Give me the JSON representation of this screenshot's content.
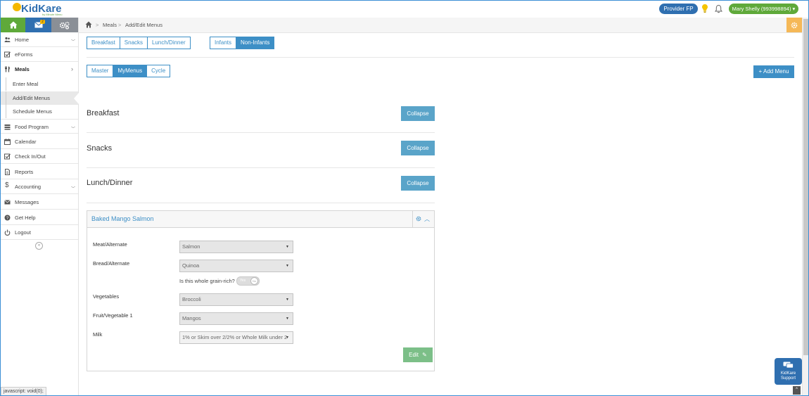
{
  "app": {
    "logo_text": "KidKare",
    "logo_subtext": "by Minute Menu",
    "provider_label": "Provider FP",
    "user_label": "Mary Shelly (993998894) ▾"
  },
  "sidebar": {
    "mail_badge": "2",
    "items": [
      {
        "label": "Home"
      },
      {
        "label": "eForms"
      },
      {
        "label": "Meals"
      },
      {
        "label": "Food Program"
      },
      {
        "label": "Calendar"
      },
      {
        "label": "Check In/Out"
      },
      {
        "label": "Reports"
      },
      {
        "label": "Accounting"
      },
      {
        "label": "Messages"
      },
      {
        "label": "Get Help"
      },
      {
        "label": "Logout"
      }
    ],
    "meals_sub": [
      {
        "label": "Enter Meal"
      },
      {
        "label": "Add/Edit Menus"
      },
      {
        "label": "Schedule Menus"
      }
    ],
    "status_text": "javascript: void(0);"
  },
  "breadcrumb": {
    "items": [
      "Meals",
      "Add/Edit Menus"
    ],
    "sep": ">"
  },
  "main": {
    "meal_tabs": [
      "Breakfast",
      "Snacks",
      "Lunch/Dinner"
    ],
    "age_tabs": [
      "Infants",
      "Non-Infants"
    ],
    "age_tab_selected": "Non-Infants",
    "menu_tabs": [
      "Master",
      "MyMenus",
      "Cycle"
    ],
    "menu_tab_selected": "MyMenus",
    "add_menu_label": "+ Add Menu",
    "sections": [
      {
        "title": "Breakfast",
        "button": "Collapse"
      },
      {
        "title": "Snacks",
        "button": "Collapse"
      },
      {
        "title": "Lunch/Dinner",
        "button": "Collapse"
      }
    ],
    "menu_card": {
      "title": "Baked Mango Salmon",
      "fields": [
        {
          "label": "Meat/Alternate",
          "value": "Salmon"
        },
        {
          "label": "Bread/Alternate",
          "value": "Quinoa"
        },
        {
          "label": "Vegetables",
          "value": "Broccoli"
        },
        {
          "label": "Fruit/Vegetable 1",
          "value": "Mangos"
        },
        {
          "label": "Milk",
          "value": "1% or Skim over 2/2% or Whole Milk under 2"
        }
      ],
      "grain_question": "Is this whole grain-rich?",
      "grain_toggle_on": "Yes",
      "grain_toggle_off": "No",
      "edit_label": "Edit"
    }
  },
  "support": {
    "label_line1": "KidKare",
    "label_line2": "Support"
  },
  "colors": {
    "brand_blue": "#2f6fb0",
    "brand_green": "#5fa93a",
    "accent_blue": "#3d8fc6",
    "collapse_blue": "#5aa4c9",
    "edit_green": "#7cbf88"
  }
}
